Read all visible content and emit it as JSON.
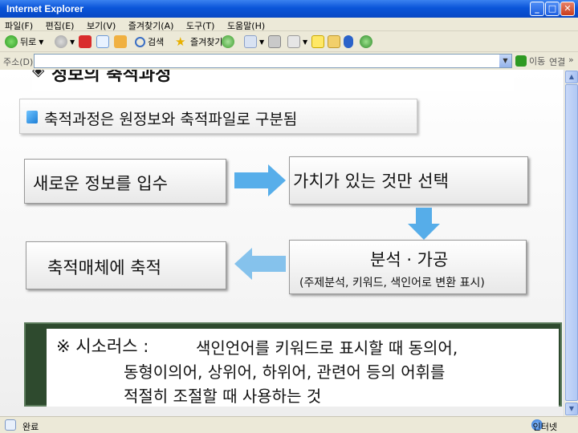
{
  "window": {
    "title": "Internet Explorer",
    "min_label": "_",
    "max_label": "□",
    "close_label": "✕"
  },
  "menu": [
    "파일(F)",
    "편집(E)",
    "보기(V)",
    "즐겨찾기(A)",
    "도구(T)",
    "도움말(H)"
  ],
  "toolbar": {
    "back_label": "뒤로",
    "search_label": "검색",
    "favorites_label": "즐겨찾기"
  },
  "address": {
    "label": "주소(D)",
    "go_label": "이동",
    "links_label": "연결",
    "more_label": "»"
  },
  "slide": {
    "title": "정보의 축적과정",
    "subtitle": "축적과정은 원정보와 축적파일로 구분됨",
    "step1": "새로운 정보를 입수",
    "step2": "가치가 있는 것만 선택",
    "step3_main": "분석 · 가공",
    "step3_sub": "(주제분석, 키워드, 색인어로 변환 표시)",
    "step4": "축적매체에 축적",
    "note_line1_prefix": "※ 시소러스 :",
    "note_line1_rest": "색인언어를 키워드로 표시할 때 동의어,",
    "note_line2": "동형이의어, 상위어, 하위어, 관련어 등의 어휘를",
    "note_line3": "적절히 조절할 때 사용하는 것"
  },
  "status": {
    "text": "완료",
    "zone": "인터넷"
  },
  "colors": {
    "titlebar": "#0a55d9",
    "arrow": "#3aa0e6",
    "note_frame": "#2e4a2e"
  }
}
